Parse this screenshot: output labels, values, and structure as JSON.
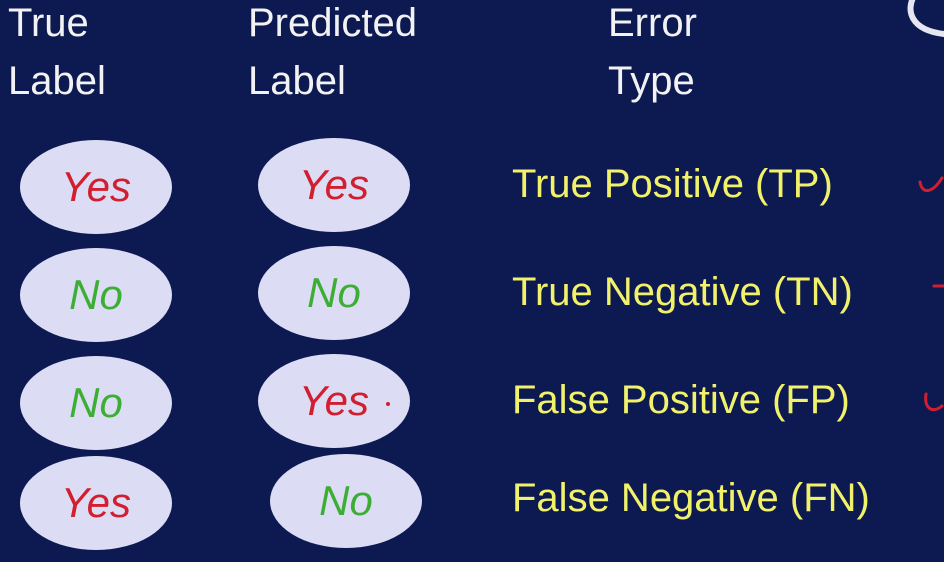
{
  "headers": {
    "true_label": [
      "True",
      "Label"
    ],
    "predicted_label": [
      "Predicted",
      "Label"
    ],
    "error_type": [
      "Error",
      "Type"
    ]
  },
  "rows": [
    {
      "true_label": "Yes",
      "predicted_label": "Yes",
      "error_type": "True Positive (TP)"
    },
    {
      "true_label": "No",
      "predicted_label": "No",
      "error_type": "True Negative (TN)"
    },
    {
      "true_label": "No",
      "predicted_label": "Yes",
      "error_type": "False Positive (FP)"
    },
    {
      "true_label": "Yes",
      "predicted_label": "No",
      "error_type": "False Negative (FN)"
    }
  ],
  "colors": {
    "background": "#0d1a52",
    "header_text": "#f2f2f2",
    "error_text": "#f1f16a",
    "ellipse_fill": "#dcdcf4",
    "yes_text": "#d21e2e",
    "no_text": "#3cae34",
    "annotation": "#d21e2e"
  }
}
